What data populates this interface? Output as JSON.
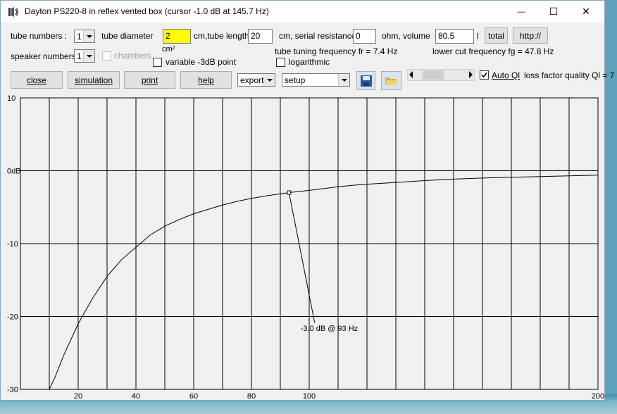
{
  "window": {
    "title": "Dayton PS220-8 in reflex vented box (cursor -1.0 dB at 145.7 Hz)",
    "controls": {
      "minimize": "—",
      "maximize": "☐",
      "close": "✕"
    }
  },
  "params": {
    "tube_numbers_label": "tube numbers :",
    "tube_numbers_value": "1",
    "tube_diameter_label": "tube diameter",
    "tube_diameter_value": "2",
    "tube_length_label": "cm,tube length",
    "tube_length_value": "20",
    "serial_resistance_label": "cm, serial resistance",
    "serial_resistance_value": "0",
    "volume_label": "ohm, volume",
    "volume_value": "80.5",
    "volume_unit": "l",
    "total_button": "total",
    "http_button": "http://",
    "speaker_numbers_label": "speaker numbers :",
    "speaker_numbers_value": "1",
    "chambers_label": "chambers",
    "cm2_label": "cm²",
    "variable_3db_label": "variable -3dB point",
    "tuning_frequency": "tube tuning frequency fr = 7.4 Hz",
    "logarithmic_label": "logarithmic",
    "lower_cut_frequency": "lower cut frequency fg = 47.8 Hz"
  },
  "toolbar": {
    "close": "close",
    "simulation": "simulation",
    "print": "print",
    "help": "help",
    "export_value": "export",
    "setup_value": "setup",
    "auto_ql_label": "Auto Ql",
    "auto_ql_checked": true,
    "quality_label": "loss factor quality Ql = 7",
    "scroll_position": 0.25
  },
  "colors": {
    "highlight_field": "#ffff00",
    "plot_bg": "#f0f0f0",
    "grid": "#000000"
  },
  "chart_data": {
    "type": "line",
    "x_axis": {
      "range": [
        0,
        200
      ],
      "ticks": [
        20,
        40,
        60,
        80,
        100,
        200
      ],
      "tick_labels": [
        "20",
        "40",
        "60",
        "80",
        "100",
        "200"
      ]
    },
    "y_axis": {
      "range": [
        -30,
        10
      ],
      "ticks": [
        10,
        0,
        -10,
        -20,
        -30
      ],
      "tick_labels": [
        "10",
        "0dB",
        "-10",
        "-20",
        "-30"
      ]
    },
    "grid": true,
    "series": [
      {
        "points": [
          [
            10,
            -30
          ],
          [
            12,
            -28.3
          ],
          [
            15,
            -25.3
          ],
          [
            20,
            -21
          ],
          [
            25,
            -17.5
          ],
          [
            30,
            -14.5
          ],
          [
            35,
            -12.2
          ],
          [
            40,
            -10.5
          ],
          [
            45,
            -8.8
          ],
          [
            50,
            -7.6
          ],
          [
            55,
            -6.7
          ],
          [
            60,
            -5.9
          ],
          [
            65,
            -5.3
          ],
          [
            70,
            -4.7
          ],
          [
            75,
            -4.2
          ],
          [
            80,
            -3.8
          ],
          [
            85,
            -3.45
          ],
          [
            93,
            -3.0
          ],
          [
            100,
            -2.7
          ],
          [
            105,
            -2.45
          ],
          [
            110,
            -2.2
          ],
          [
            115,
            -2.0
          ],
          [
            120,
            -1.85
          ],
          [
            130,
            -1.6
          ],
          [
            140,
            -1.35
          ],
          [
            150,
            -1.15
          ],
          [
            160,
            -1.0
          ],
          [
            170,
            -0.9
          ],
          [
            180,
            -0.8
          ],
          [
            190,
            -0.7
          ],
          [
            200,
            -0.6
          ]
        ]
      }
    ],
    "marker": {
      "x": 93,
      "y": -3.0,
      "label": "-3.0 dB @ 93 Hz",
      "label_x": 97,
      "label_y": -22
    }
  }
}
